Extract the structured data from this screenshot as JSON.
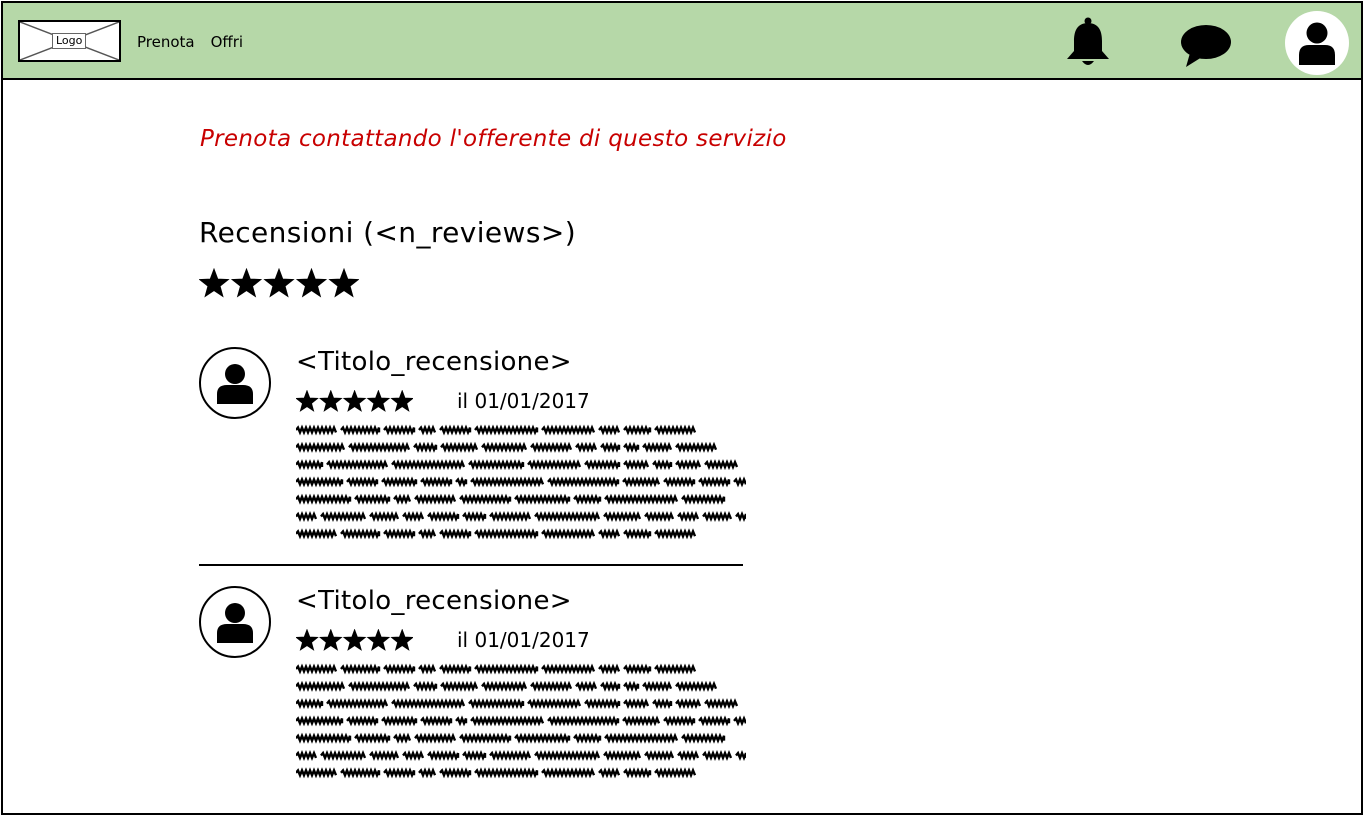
{
  "header": {
    "logo_label": "Logo",
    "nav": [
      {
        "label": "Prenota"
      },
      {
        "label": "Offri"
      }
    ],
    "icons": [
      "bell-icon",
      "chat-icon",
      "user-icon"
    ],
    "background": "#b6d8a8"
  },
  "contact_link": {
    "text": "Prenota contattando l'offerente di questo servizio",
    "color": "#c80000"
  },
  "reviews": {
    "heading": "Recensioni  (<n_reviews>)",
    "overall_rating": 5,
    "items": [
      {
        "title": "<Titolo_recensione>",
        "rating": 5,
        "date": "il 01/01/2017"
      },
      {
        "title": "<Titolo_recensione>",
        "rating": 5,
        "date": "il 01/01/2017"
      }
    ]
  }
}
